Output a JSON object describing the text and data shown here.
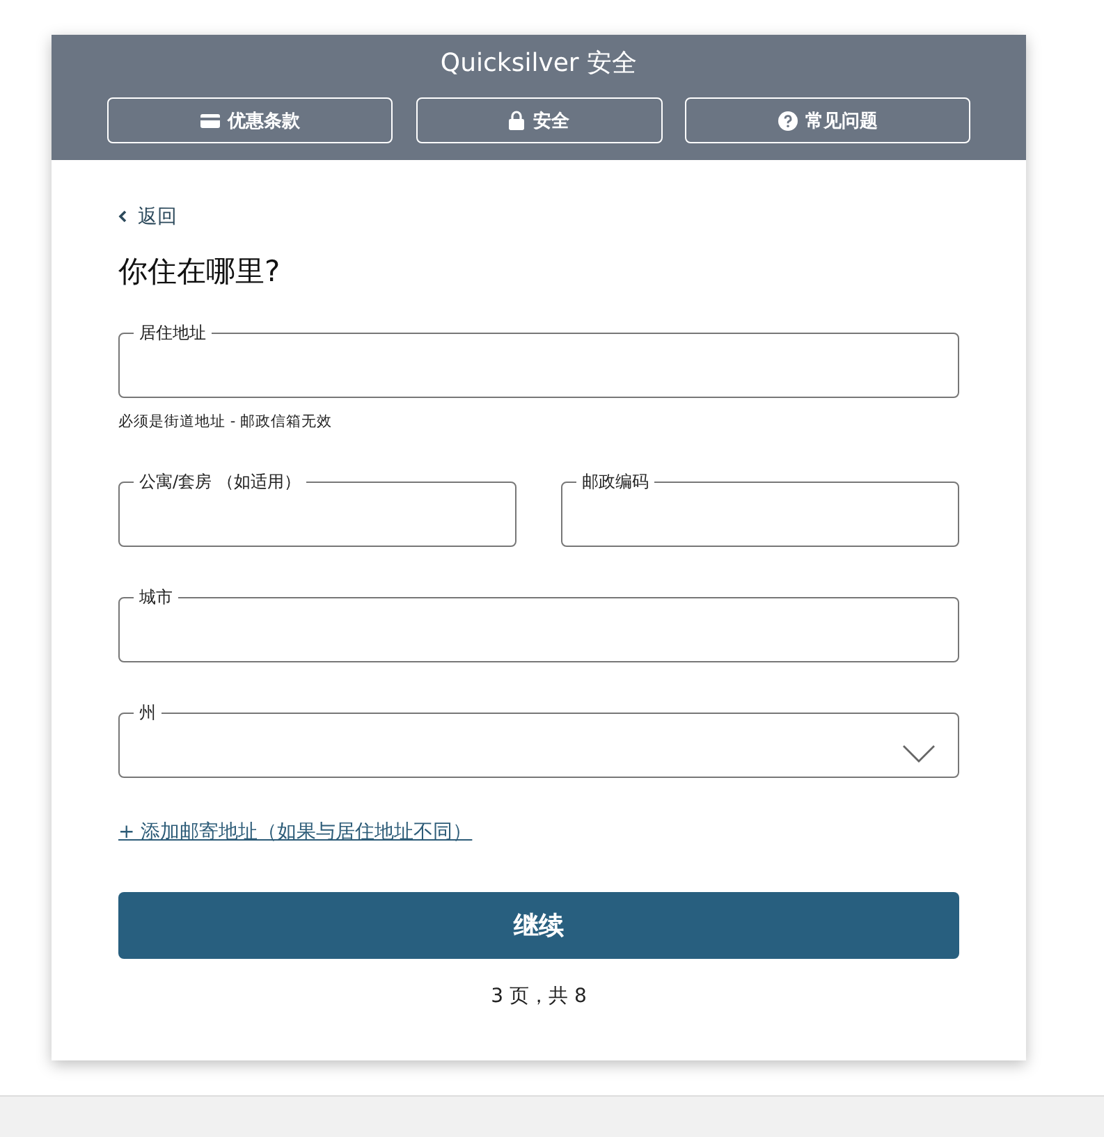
{
  "header": {
    "title": "Quicksilver 安全",
    "tabs": [
      {
        "label": "优惠条款"
      },
      {
        "label": "安全"
      },
      {
        "label": "常见问题"
      }
    ]
  },
  "back_link": "返回",
  "heading": "你住在哪里?",
  "field_rows": [
    {
      "fields": [
        {
          "kind": "text",
          "label": "居住地址",
          "hint": "必须是街道地址 - 邮政信箱无效"
        }
      ]
    },
    {
      "fields": [
        {
          "kind": "text",
          "label": "公寓/套房 （如适用）"
        },
        {
          "kind": "text",
          "label": "邮政编码"
        }
      ]
    },
    {
      "fields": [
        {
          "kind": "text",
          "label": "城市"
        }
      ]
    },
    {
      "fields": [
        {
          "kind": "select",
          "label": "州"
        }
      ]
    }
  ],
  "add_link": "+ 添加邮寄地址（如果与居住地址不同）",
  "continue_button": "继续",
  "page_indicator": "3 页，共 8"
}
